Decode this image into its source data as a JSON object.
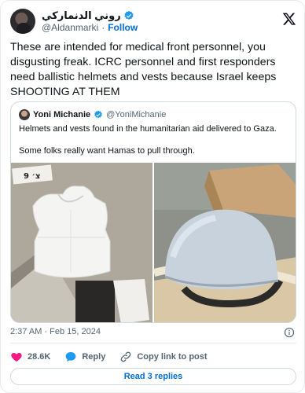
{
  "author": {
    "display_name": "روني الدنماركي",
    "handle": "@Aldanmarki",
    "separator": "·",
    "follow_label": "Follow"
  },
  "tweet": {
    "text": "These are intended for medical front personnel, you disgusting freak. ICRC personnel and first responders need ballistic helmets and vests because Israel keeps SHOOTING AT THEM"
  },
  "quoted_tweet": {
    "display_name": "Yoni Michanie",
    "handle": "@YoniMichanie",
    "text_line1": "Helmets and vests found in the humanitarian aid delivered to Gaza.",
    "text_line2": "Some folks really want Hamas to pull through.",
    "image_left_marking": "9 צ׳"
  },
  "meta": {
    "timestamp": "2:37 AM · Feb 15, 2024"
  },
  "actions": {
    "like_count": "28.6K",
    "reply_label": "Reply",
    "copy_label": "Copy link to post"
  },
  "read_replies_label": "Read 3 replies",
  "colors": {
    "verified": "#1d9bf0",
    "link": "#006fd6",
    "like": "#f91880",
    "reply": "#1d9bf0"
  },
  "icons": [
    "x-logo-icon",
    "verified-badge-icon",
    "info-icon",
    "heart-icon",
    "reply-bubble-icon",
    "link-icon"
  ]
}
